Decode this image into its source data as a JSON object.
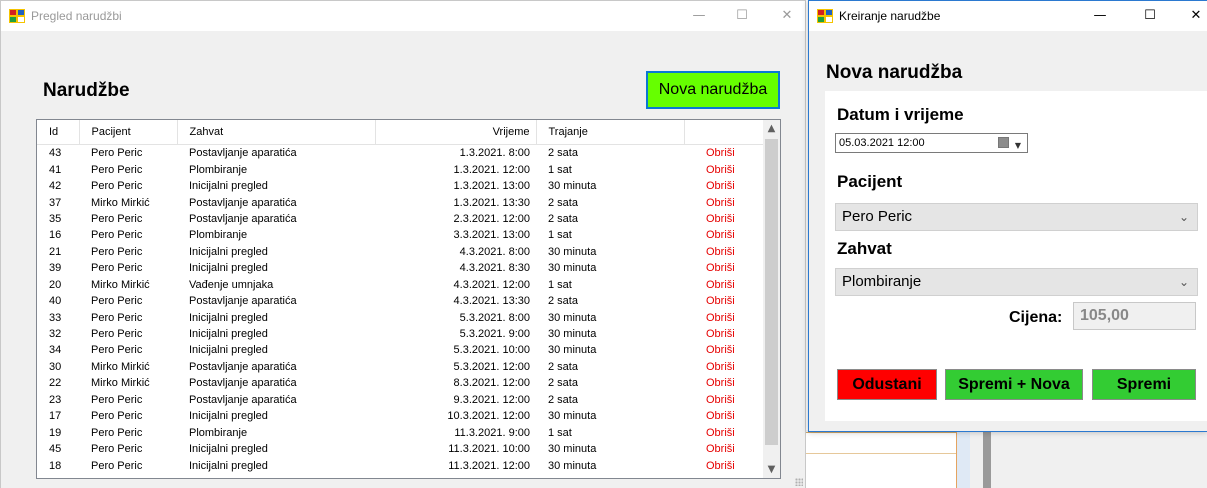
{
  "left_window": {
    "title": "Pregled narudžbi",
    "heading": "Narudžbe",
    "new_button": "Nova narudžba",
    "columns": [
      "Id",
      "Pacijent",
      "Zahvat",
      "Vrijeme",
      "Trajanje",
      ""
    ],
    "delete_label": "Obriši",
    "rows": [
      [
        "43",
        "Pero Peric",
        "Postavljanje aparatića",
        "1.3.2021. 8:00",
        "2 sata"
      ],
      [
        "41",
        "Pero Peric",
        "Plombiranje",
        "1.3.2021. 12:00",
        "1 sat"
      ],
      [
        "42",
        "Pero Peric",
        "Inicijalni pregled",
        "1.3.2021. 13:00",
        "30 minuta"
      ],
      [
        "37",
        "Mirko Mirkić",
        "Postavljanje aparatića",
        "1.3.2021. 13:30",
        "2 sata"
      ],
      [
        "35",
        "Pero Peric",
        "Postavljanje aparatića",
        "2.3.2021. 12:00",
        "2 sata"
      ],
      [
        "16",
        "Pero Peric",
        "Plombiranje",
        "3.3.2021. 13:00",
        "1 sat"
      ],
      [
        "21",
        "Pero Peric",
        "Inicijalni pregled",
        "4.3.2021. 8:00",
        "30 minuta"
      ],
      [
        "39",
        "Pero Peric",
        "Inicijalni pregled",
        "4.3.2021. 8:30",
        "30 minuta"
      ],
      [
        "20",
        "Mirko Mirkić",
        "Vađenje umnjaka",
        "4.3.2021. 12:00",
        "1 sat"
      ],
      [
        "40",
        "Pero Peric",
        "Postavljanje aparatića",
        "4.3.2021. 13:30",
        "2 sata"
      ],
      [
        "33",
        "Pero Peric",
        "Inicijalni pregled",
        "5.3.2021. 8:00",
        "30 minuta"
      ],
      [
        "32",
        "Pero Peric",
        "Inicijalni pregled",
        "5.3.2021. 9:00",
        "30 minuta"
      ],
      [
        "34",
        "Pero Peric",
        "Inicijalni pregled",
        "5.3.2021. 10:00",
        "30 minuta"
      ],
      [
        "30",
        "Mirko Mirkić",
        "Postavljanje aparatića",
        "5.3.2021. 12:00",
        "2 sata"
      ],
      [
        "22",
        "Mirko Mirkić",
        "Postavljanje aparatića",
        "8.3.2021. 12:00",
        "2 sata"
      ],
      [
        "23",
        "Pero Peric",
        "Postavljanje aparatića",
        "9.3.2021. 12:00",
        "2 sata"
      ],
      [
        "17",
        "Pero Peric",
        "Inicijalni pregled",
        "10.3.2021. 12:00",
        "30 minuta"
      ],
      [
        "19",
        "Pero Peric",
        "Plombiranje",
        "11.3.2021. 9:00",
        "1 sat"
      ],
      [
        "45",
        "Pero Peric",
        "Inicijalni pregled",
        "11.3.2021. 10:00",
        "30 minuta"
      ],
      [
        "18",
        "Pero Peric",
        "Inicijalni pregled",
        "11.3.2021. 12:00",
        "30 minuta"
      ]
    ]
  },
  "right_window": {
    "title": "Kreiranje narudžbe",
    "heading": "Nova narudžba",
    "datetime_label": "Datum i vrijeme",
    "datetime_value": "05.03.2021 12:00",
    "patient_label": "Pacijent",
    "patient_value": "Pero Peric",
    "procedure_label": "Zahvat",
    "procedure_value": "Plombiranje",
    "price_label": "Cijena:",
    "price_value": "105,00",
    "cancel_button": "Odustani",
    "save_new_button": "Spremi + Nova",
    "save_button": "Spremi"
  },
  "controls": {
    "minimize": "—",
    "maximize": "☐",
    "close": "✕"
  },
  "colors": {
    "new_button": "#66ff00",
    "cancel_button": "#ff0000",
    "save_buttons": "#33cc33",
    "delete_link": "#e60000"
  }
}
